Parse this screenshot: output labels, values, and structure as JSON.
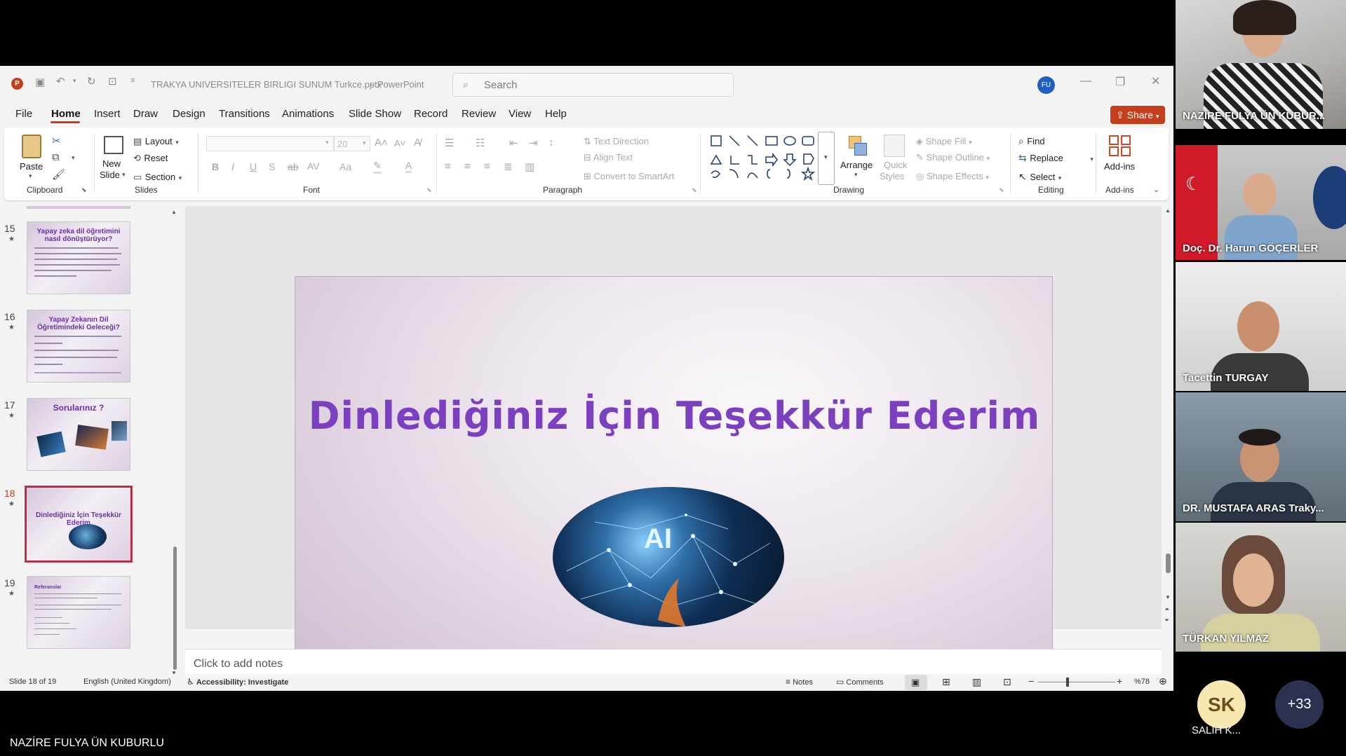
{
  "app": {
    "file_name": "TRAKYA UNIVERSITELER BIRLIGI SUNUM Turkce.pptx",
    "app_name": "PowerPoint",
    "search_placeholder": "Search",
    "user_initials": "FU",
    "share_label": "Share"
  },
  "menu": [
    "File",
    "Home",
    "Insert",
    "Draw",
    "Design",
    "Transitions",
    "Animations",
    "Slide Show",
    "Record",
    "Review",
    "View",
    "Help"
  ],
  "ribbon": {
    "clipboard": {
      "paste": "Paste",
      "group": "Clipboard"
    },
    "slides": {
      "new_slide_1": "New",
      "new_slide_2": "Slide",
      "layout": "Layout",
      "reset": "Reset",
      "section": "Section",
      "group": "Slides"
    },
    "font": {
      "size": "20",
      "group": "Font"
    },
    "paragraph": {
      "text_direction": "Text Direction",
      "align_text": "Align Text",
      "convert_smartart": "Convert to SmartArt",
      "group": "Paragraph"
    },
    "drawing": {
      "arrange": "Arrange",
      "quick_styles_1": "Quick",
      "quick_styles_2": "Styles",
      "shape_fill": "Shape Fill",
      "shape_outline": "Shape Outline",
      "shape_effects": "Shape Effects",
      "group": "Drawing"
    },
    "editing": {
      "find": "Find",
      "replace": "Replace",
      "select": "Select",
      "group": "Editing"
    },
    "addins": {
      "label": "Add-ins",
      "group": "Add-ins"
    }
  },
  "thumbnails": [
    {
      "num": "15",
      "title": "Yapay zeka dil öğretimini nasıl dönüştürüyor?"
    },
    {
      "num": "16",
      "title": "Yapay Zekanın Dil Öğretimindeki Geleceği?"
    },
    {
      "num": "17",
      "title": "Sorularınız ?"
    },
    {
      "num": "18",
      "title": "Dinlediğiniz İçin Teşekkür Ederim"
    },
    {
      "num": "19",
      "title": "Referanslar"
    }
  ],
  "slide": {
    "title": "Dinlediğiniz İçin Teşekkür Ederim",
    "image_text": "AI",
    "number": "18"
  },
  "notes_placeholder": "Click to add notes",
  "status": {
    "slide_info": "Slide 18 of 19",
    "language": "English (United Kingdom)",
    "accessibility": "Accessibility: Investigate",
    "notes": "Notes",
    "comments": "Comments",
    "zoom": "%78"
  },
  "participants": [
    {
      "name": "NAZİRE FULYA ÜN KUBUR..."
    },
    {
      "name": "Doç. Dr. Harun GÖÇERLER"
    },
    {
      "name": "Tacettin TURGAY"
    },
    {
      "name": "DR. MUSTAFA ARAS Traky..."
    },
    {
      "name": "TÜRKAN YILMAZ"
    }
  ],
  "extra": {
    "avatar_initials": "SK",
    "avatar_name": "SALİH K...",
    "more_count": "+33"
  },
  "presenter_name": "NAZİRE FULYA ÜN KUBURLU",
  "colors": {
    "accent": "#c43e1c",
    "slide_title": "#7b3fc0",
    "selected_thumb": "#b8233e"
  }
}
